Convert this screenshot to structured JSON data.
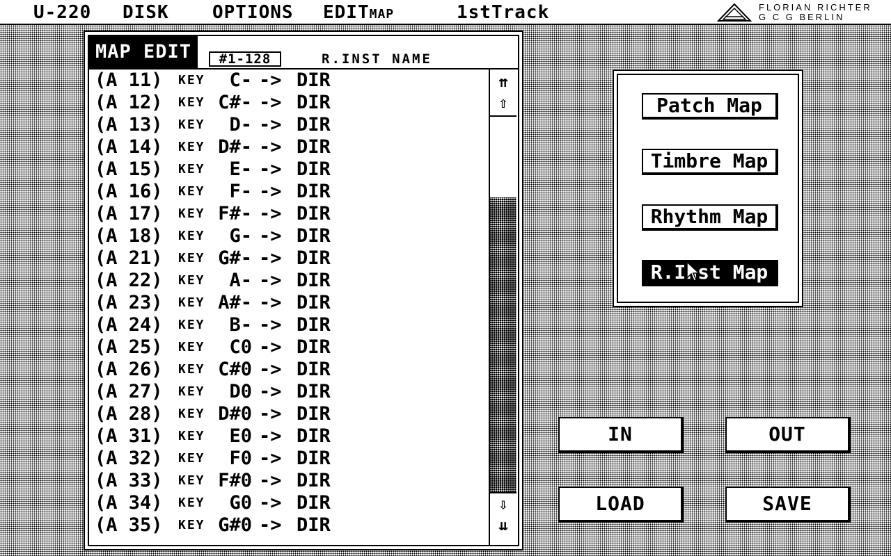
{
  "menubar": {
    "items": [
      "U-220",
      "DISK",
      "OPTIONS",
      "EDIT",
      "1stTrack"
    ],
    "edit_sub": "MAP",
    "logo_line1": "FLORIAN RICHTER",
    "logo_line2": "G C G  BERLIN"
  },
  "editor": {
    "title": "MAP EDIT",
    "range": "#1-128",
    "column_name": "R.INST NAME",
    "rows": [
      {
        "id": "(A 11)",
        "key": "KEY",
        "note": "C-",
        "arrow": "->",
        "dest": "DIR"
      },
      {
        "id": "(A 12)",
        "key": "KEY",
        "note": "C#-",
        "arrow": "->",
        "dest": "DIR"
      },
      {
        "id": "(A 13)",
        "key": "KEY",
        "note": "D-",
        "arrow": "->",
        "dest": "DIR"
      },
      {
        "id": "(A 14)",
        "key": "KEY",
        "note": "D#-",
        "arrow": "->",
        "dest": "DIR"
      },
      {
        "id": "(A 15)",
        "key": "KEY",
        "note": "E-",
        "arrow": "->",
        "dest": "DIR"
      },
      {
        "id": "(A 16)",
        "key": "KEY",
        "note": "F-",
        "arrow": "->",
        "dest": "DIR"
      },
      {
        "id": "(A 17)",
        "key": "KEY",
        "note": "F#-",
        "arrow": "->",
        "dest": "DIR"
      },
      {
        "id": "(A 18)",
        "key": "KEY",
        "note": "G-",
        "arrow": "->",
        "dest": "DIR"
      },
      {
        "id": "(A 21)",
        "key": "KEY",
        "note": "G#-",
        "arrow": "->",
        "dest": "DIR"
      },
      {
        "id": "(A 22)",
        "key": "KEY",
        "note": "A-",
        "arrow": "->",
        "dest": "DIR"
      },
      {
        "id": "(A 23)",
        "key": "KEY",
        "note": "A#-",
        "arrow": "->",
        "dest": "DIR"
      },
      {
        "id": "(A 24)",
        "key": "KEY",
        "note": "B-",
        "arrow": "->",
        "dest": "DIR"
      },
      {
        "id": "(A 25)",
        "key": "KEY",
        "note": "C0",
        "arrow": "->",
        "dest": "DIR"
      },
      {
        "id": "(A 26)",
        "key": "KEY",
        "note": "C#0",
        "arrow": "->",
        "dest": "DIR"
      },
      {
        "id": "(A 27)",
        "key": "KEY",
        "note": "D0",
        "arrow": "->",
        "dest": "DIR"
      },
      {
        "id": "(A 28)",
        "key": "KEY",
        "note": "D#0",
        "arrow": "->",
        "dest": "DIR"
      },
      {
        "id": "(A 31)",
        "key": "KEY",
        "note": "E0",
        "arrow": "->",
        "dest": "DIR"
      },
      {
        "id": "(A 32)",
        "key": "KEY",
        "note": "F0",
        "arrow": "->",
        "dest": "DIR"
      },
      {
        "id": "(A 33)",
        "key": "KEY",
        "note": "F#0",
        "arrow": "->",
        "dest": "DIR"
      },
      {
        "id": "(A 34)",
        "key": "KEY",
        "note": "G0",
        "arrow": "->",
        "dest": "DIR"
      },
      {
        "id": "(A 35)",
        "key": "KEY",
        "note": "G#0",
        "arrow": "->",
        "dest": "DIR"
      }
    ]
  },
  "scrollbar": {
    "top_icon": "double-up-arrow-icon",
    "up_icon": "up-arrow-icon",
    "down_icon": "down-arrow-icon",
    "bottom_icon": "double-down-arrow-icon",
    "thumb_start_fraction": 0.215,
    "thumb_end_fraction": 1.0
  },
  "map_panel": {
    "buttons": [
      "Patch Map",
      "Timbre Map",
      "Rhythm Map",
      "R.Inst Map"
    ],
    "active": "R.Inst Map"
  },
  "actions": {
    "in": "IN",
    "out": "OUT",
    "load": "LOAD",
    "save": "SAVE"
  }
}
